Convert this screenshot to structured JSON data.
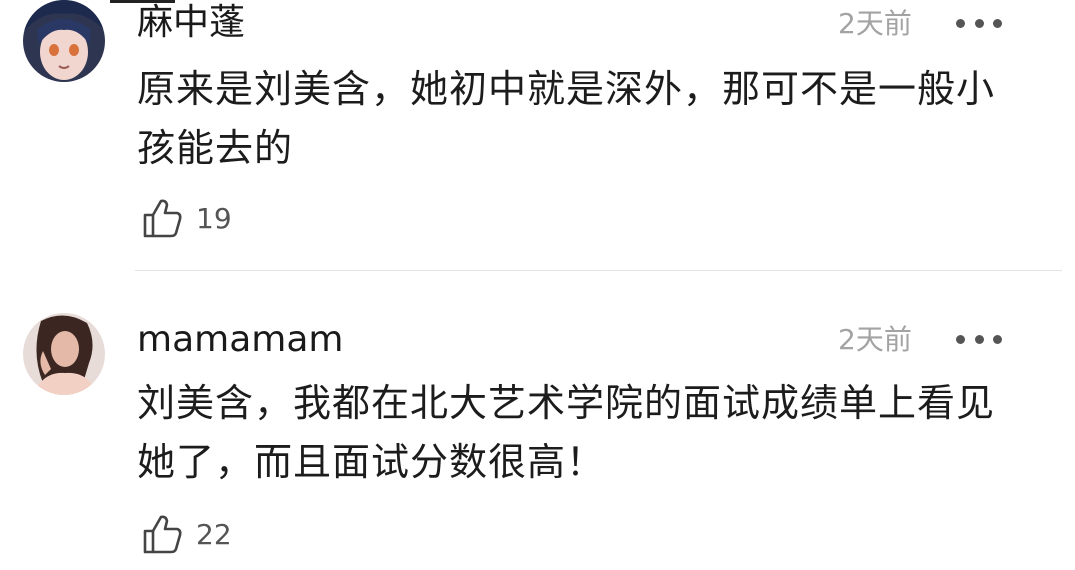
{
  "comments": [
    {
      "username": "麻中蓬",
      "time": "2天前",
      "text": "原来是刘美含，她初中就是深外，那可不是一般小孩能去的",
      "likes": "19",
      "avatar_icon": "anime-avatar"
    },
    {
      "username": "mamamam",
      "time": "2天前",
      "text": "刘美含，我都在北大艺术学院的面试成绩单上看见她了，而且面试分数很高！",
      "likes": "22",
      "avatar_icon": "photo-avatar"
    }
  ],
  "icons": {
    "more": "more-dots-icon",
    "like": "thumbs-up-icon"
  },
  "colors": {
    "text": "#1c1c1c",
    "muted": "#a3a3a3",
    "divider": "#e2e2e2"
  }
}
